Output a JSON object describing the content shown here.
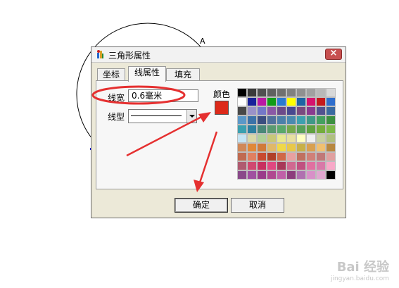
{
  "dialog": {
    "title": "三角形属性",
    "close_label": "×"
  },
  "tabs": [
    {
      "label": "坐标"
    },
    {
      "label": "线属性"
    },
    {
      "label": "填充"
    }
  ],
  "line_props": {
    "width_label": "线宽",
    "width_value": "0.6毫米",
    "type_label": "线型",
    "color_label": "颜色",
    "current_color": "#dd2a1a"
  },
  "palette": [
    "#000000",
    "#3a3a3a",
    "#505050",
    "#606060",
    "#707070",
    "#808080",
    "#909090",
    "#a0a0a0",
    "#b8b8b8",
    "#d8d8d8",
    "#ffffff",
    "#18209a",
    "#bb18a4",
    "#119c16",
    "#2a7ad0",
    "#ffff00",
    "#1e64a4",
    "#d6126e",
    "#c41a1c",
    "#2f6ecd",
    "#484848",
    "#9a92c8",
    "#7478c8",
    "#8a58a6",
    "#6c4a8a",
    "#484890",
    "#7a4a80",
    "#8a3a90",
    "#525290",
    "#3a6aa0",
    "#5a98c8",
    "#3c72a8",
    "#3b4e80",
    "#50709c",
    "#4c80aa",
    "#4a8ab0",
    "#3ea0b0",
    "#409888",
    "#44a060",
    "#3c9040",
    "#3aa0b0",
    "#2e80a0",
    "#4a8878",
    "#5a9a70",
    "#5aa86a",
    "#74a84c",
    "#58a058",
    "#60a040",
    "#74ac3c",
    "#7cb848",
    "#c4e4f4",
    "#d8d8a8",
    "#b0d098",
    "#c8c878",
    "#e8e890",
    "#e8e0a0",
    "#ffffc0",
    "#f0f0f0",
    "#c8d0a0",
    "#b0c080",
    "#d08858",
    "#e08838",
    "#d07a3a",
    "#e0b868",
    "#f0d848",
    "#e8c848",
    "#c8b048",
    "#d8a050",
    "#f0c070",
    "#b88840",
    "#c06a50",
    "#e08060",
    "#c84a30",
    "#b04028",
    "#d06848",
    "#e8a0a0",
    "#c07060",
    "#d08078",
    "#c07878",
    "#e0a0a0",
    "#b05a70",
    "#d04870",
    "#c83060",
    "#e04880",
    "#a83858",
    "#d06890",
    "#c05080",
    "#e070a0",
    "#d878a8",
    "#f8a8c8",
    "#8a4a8a",
    "#a050a0",
    "#9a3c8a",
    "#b04890",
    "#c060a8",
    "#8c3c7c",
    "#b070b0",
    "#d890c8",
    "#e0a8d0",
    "#000000"
  ],
  "buttons": {
    "ok": "确定",
    "cancel": "取消"
  },
  "watermark": {
    "logo": "Bai 经验",
    "url": "jingyan.baidu.com"
  },
  "background": {
    "point_label": "A"
  }
}
